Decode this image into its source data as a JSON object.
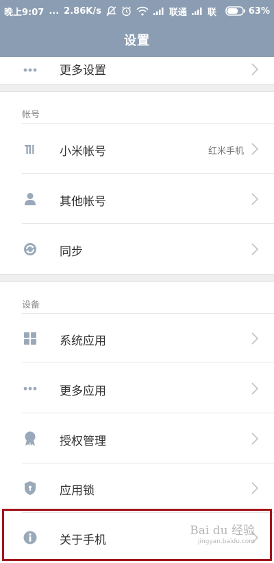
{
  "status_bar": {
    "time": "晚上9:07",
    "dots": "...",
    "speed": "2.86K/s",
    "carrier": "联通",
    "carrier2": "联",
    "battery": "63%"
  },
  "header": {
    "title": "设置"
  },
  "partial_row": {
    "label": "更多设置"
  },
  "sections": {
    "account": {
      "title": "帐号",
      "items": [
        {
          "label": "小米帐号",
          "value": "红米手机",
          "icon": "mi-logo-icon"
        },
        {
          "label": "其他帐号",
          "icon": "person-icon"
        },
        {
          "label": "同步",
          "icon": "sync-icon"
        }
      ]
    },
    "device": {
      "title": "设备",
      "items": [
        {
          "label": "系统应用",
          "icon": "grid-icon"
        },
        {
          "label": "更多应用",
          "icon": "dots-icon"
        },
        {
          "label": "授权管理",
          "icon": "badge-icon"
        },
        {
          "label": "应用锁",
          "icon": "shield-lock-icon"
        },
        {
          "label": "关于手机",
          "icon": "info-icon"
        }
      ]
    }
  },
  "watermark": {
    "main": "Bai du 经验",
    "sub": "jingyan.baidu.com"
  },
  "colors": {
    "header": "#8b9db2",
    "icon": "#9aa9ba",
    "highlight": "#a3141b"
  }
}
